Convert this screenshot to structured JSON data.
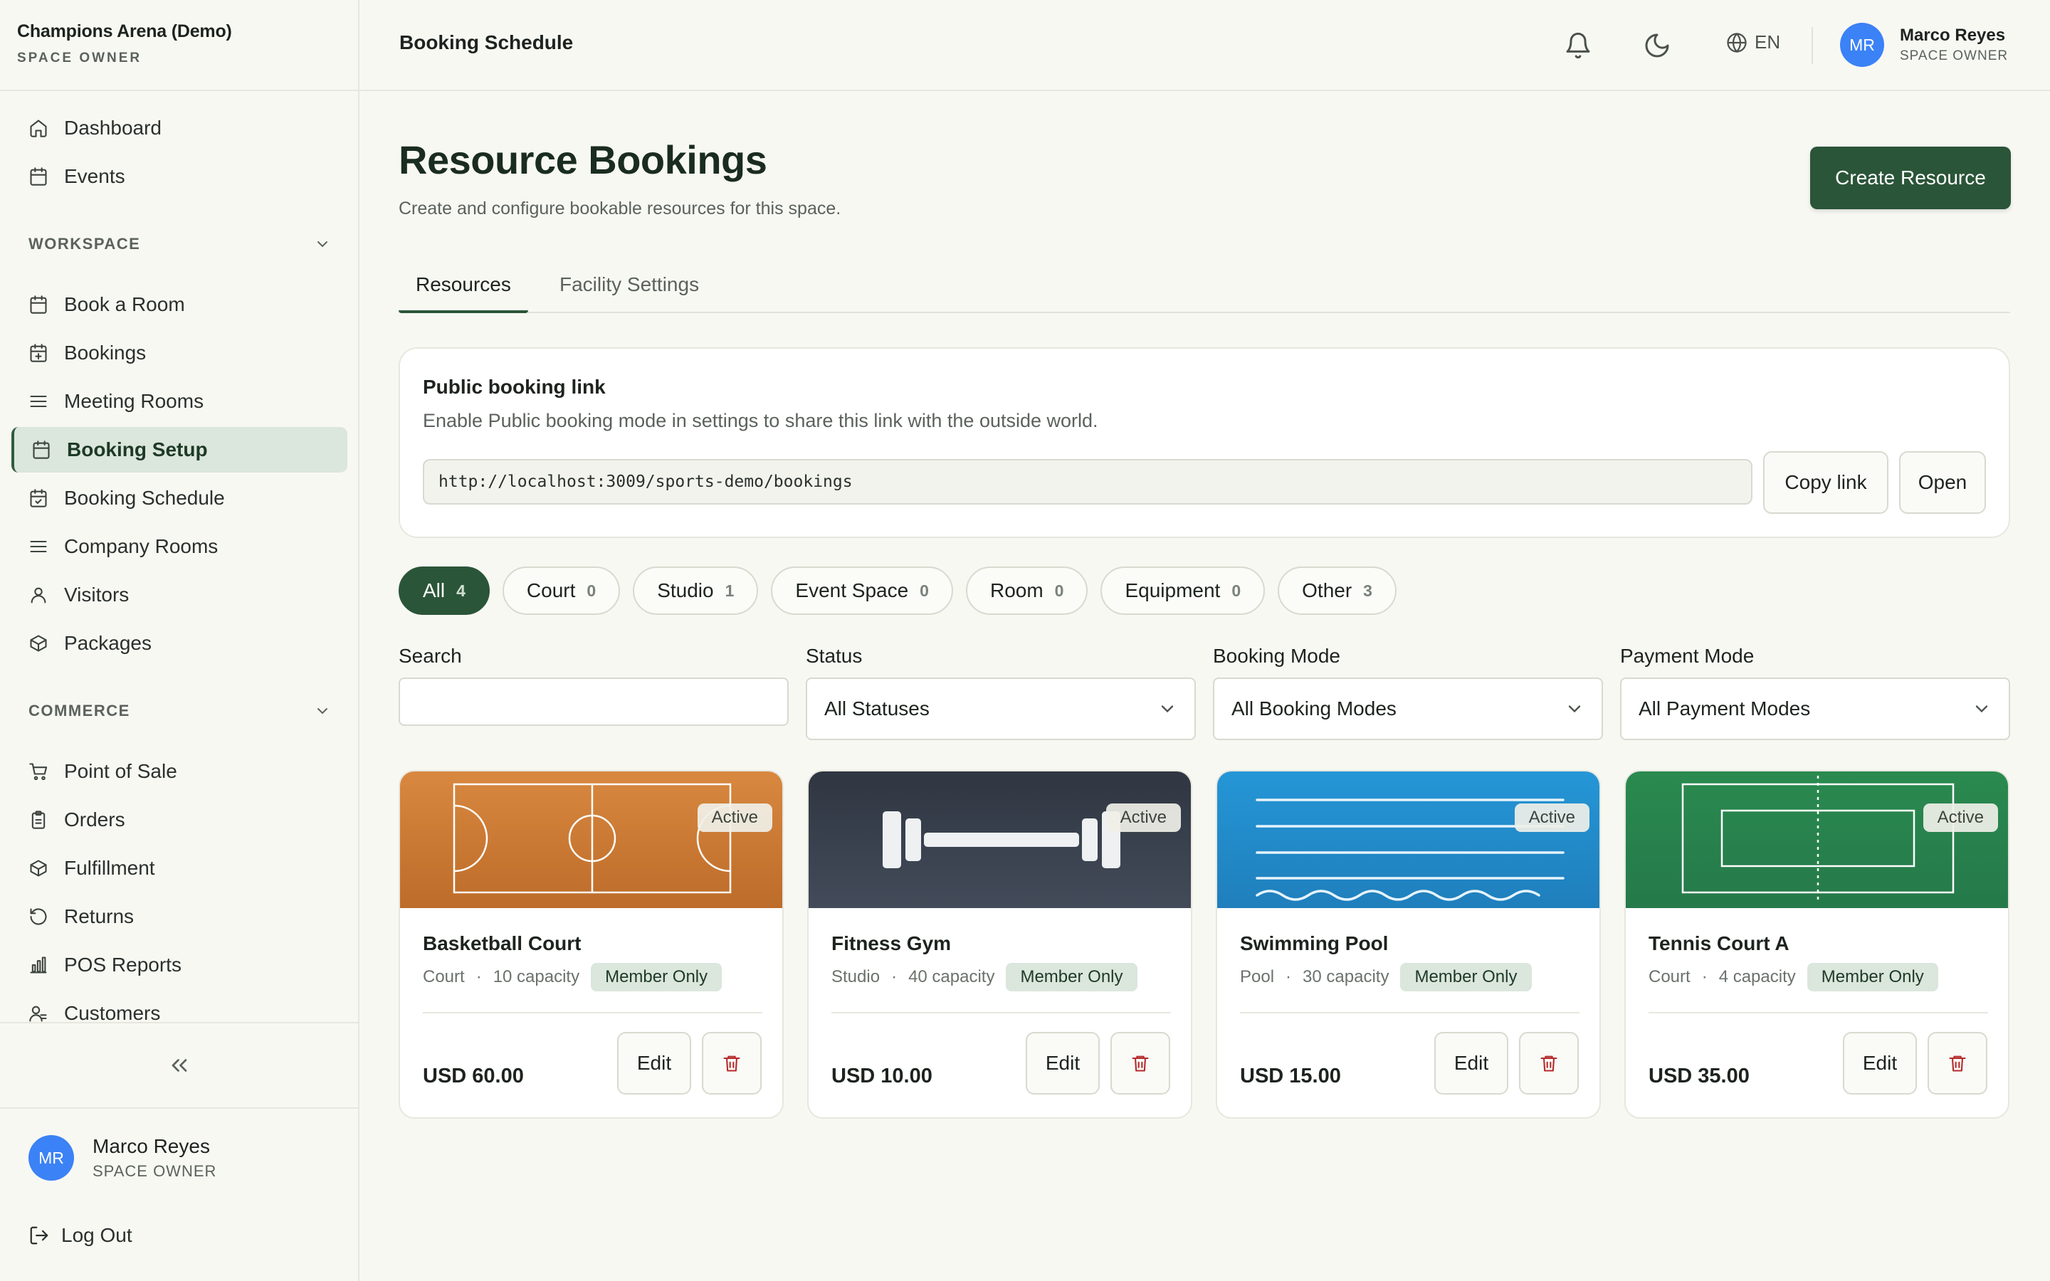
{
  "app": {
    "brand_name": "Champions Arena (Demo)",
    "brand_role": "SPACE OWNER"
  },
  "sidebar": {
    "top_items": [
      {
        "label": "Dashboard",
        "icon": "home-icon"
      },
      {
        "label": "Events",
        "icon": "calendar-icon"
      }
    ],
    "workspace_title": "WORKSPACE",
    "workspace_items": [
      {
        "label": "Book a Room",
        "icon": "calendar-icon"
      },
      {
        "label": "Bookings",
        "icon": "calendar-plus-icon"
      },
      {
        "label": "Meeting Rooms",
        "icon": "list-icon"
      },
      {
        "label": "Booking Setup",
        "icon": "calendar-icon",
        "active": true
      },
      {
        "label": "Booking Schedule",
        "icon": "calendar-check-icon"
      },
      {
        "label": "Company Rooms",
        "icon": "list-icon"
      },
      {
        "label": "Visitors",
        "icon": "user-icon"
      },
      {
        "label": "Packages",
        "icon": "package-icon"
      }
    ],
    "commerce_title": "COMMERCE",
    "commerce_items": [
      {
        "label": "Point of Sale",
        "icon": "cart-icon"
      },
      {
        "label": "Orders",
        "icon": "clipboard-icon"
      },
      {
        "label": "Fulfillment",
        "icon": "package-icon"
      },
      {
        "label": "Returns",
        "icon": "undo-icon"
      },
      {
        "label": "POS Reports",
        "icon": "bar-chart-icon"
      },
      {
        "label": "Customers",
        "icon": "users-icon"
      }
    ],
    "user": {
      "initials": "MR",
      "name": "Marco Reyes",
      "role": "SPACE OWNER"
    },
    "logout_label": "Log Out"
  },
  "topbar": {
    "title": "Booking Schedule",
    "language": "EN",
    "user": {
      "initials": "MR",
      "name": "Marco Reyes",
      "role": "SPACE OWNER"
    }
  },
  "page": {
    "title": "Resource Bookings",
    "subtitle": "Create and configure bookable resources for this space.",
    "create_button": "Create Resource",
    "tabs": [
      "Resources",
      "Facility Settings"
    ],
    "active_tab": "Resources"
  },
  "public_link": {
    "title": "Public booking link",
    "description": "Enable Public booking mode in settings to share this link with the outside world.",
    "url": "http://localhost:3009/sports-demo/bookings",
    "copy_label": "Copy link",
    "open_label": "Open"
  },
  "categories": [
    {
      "label": "All",
      "count": "4",
      "active": true
    },
    {
      "label": "Court",
      "count": "0"
    },
    {
      "label": "Studio",
      "count": "1"
    },
    {
      "label": "Event Space",
      "count": "0"
    },
    {
      "label": "Room",
      "count": "0"
    },
    {
      "label": "Equipment",
      "count": "0"
    },
    {
      "label": "Other",
      "count": "3"
    }
  ],
  "filters": {
    "search": {
      "label": "Search",
      "value": "",
      "placeholder": ""
    },
    "status": {
      "label": "Status",
      "value": "All Statuses"
    },
    "booking_mode": {
      "label": "Booking Mode",
      "value": "All Booking Modes"
    },
    "payment_mode": {
      "label": "Payment Mode",
      "value": "All Payment Modes"
    }
  },
  "resources": [
    {
      "name": "Basketball Court",
      "type": "Court",
      "capacity": "10 capacity",
      "tag": "Member Only",
      "status": "Active",
      "price": "USD 60.00",
      "edit_label": "Edit",
      "image": "basketball-court-image",
      "color_top": "#d8883f",
      "color_bottom": "#bd6c2a"
    },
    {
      "name": "Fitness Gym",
      "type": "Studio",
      "capacity": "40 capacity",
      "tag": "Member Only",
      "status": "Active",
      "price": "USD 10.00",
      "edit_label": "Edit",
      "image": "dumbbell-image",
      "color_top": "#2f3641",
      "color_bottom": "#434b5a"
    },
    {
      "name": "Swimming Pool",
      "type": "Pool",
      "capacity": "30 capacity",
      "tag": "Member Only",
      "status": "Active",
      "price": "USD 15.00",
      "edit_label": "Edit",
      "image": "swimming-pool-image",
      "color_top": "#2596d6",
      "color_bottom": "#1f7fbc"
    },
    {
      "name": "Tennis Court A",
      "type": "Court",
      "capacity": "4 capacity",
      "tag": "Member Only",
      "status": "Active",
      "price": "USD 35.00",
      "edit_label": "Edit",
      "image": "tennis-court-image",
      "color_top": "#2a8a4f",
      "color_bottom": "#25794a"
    }
  ],
  "colors": {
    "accent": "#2b5538",
    "active_nav_bg": "#dbe6dc",
    "avatar": "#3b82f6",
    "delete": "#b42b2b"
  }
}
